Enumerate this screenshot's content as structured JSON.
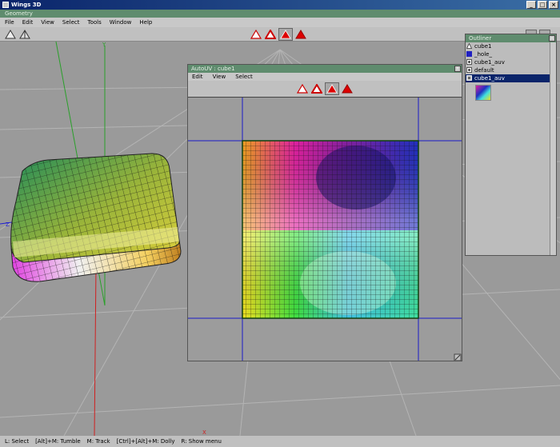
{
  "window": {
    "title": "Wings 3D",
    "minimize": "_",
    "maximize": "□",
    "close": "×"
  },
  "geometry_bar": {
    "label": "Geometry"
  },
  "menu": [
    "File",
    "Edit",
    "View",
    "Select",
    "Tools",
    "Window",
    "Help"
  ],
  "viewport": {
    "axis_x": "X",
    "axis_y": "Y",
    "axis_z": "Z"
  },
  "autouv": {
    "title": "AutoUV : cube1",
    "close": "x",
    "menu": [
      "Edit",
      "View",
      "Select"
    ]
  },
  "outliner": {
    "title": "Outliner",
    "close": "x",
    "items": [
      {
        "label": "cube1",
        "icon": "object-icon"
      },
      {
        "label": "_hole_",
        "icon": "material-icon"
      },
      {
        "label": "cube1_auv",
        "icon": "material-icon"
      },
      {
        "label": "default",
        "icon": "material-icon"
      },
      {
        "label": "cube1_auv",
        "icon": "image-icon",
        "selected": true
      }
    ]
  },
  "status": {
    "items": [
      "L: Select",
      "[Alt]+M: Tumble",
      "M: Track",
      "[Ctrl]+[Alt]+M: Dolly",
      "R: Show menu"
    ]
  }
}
